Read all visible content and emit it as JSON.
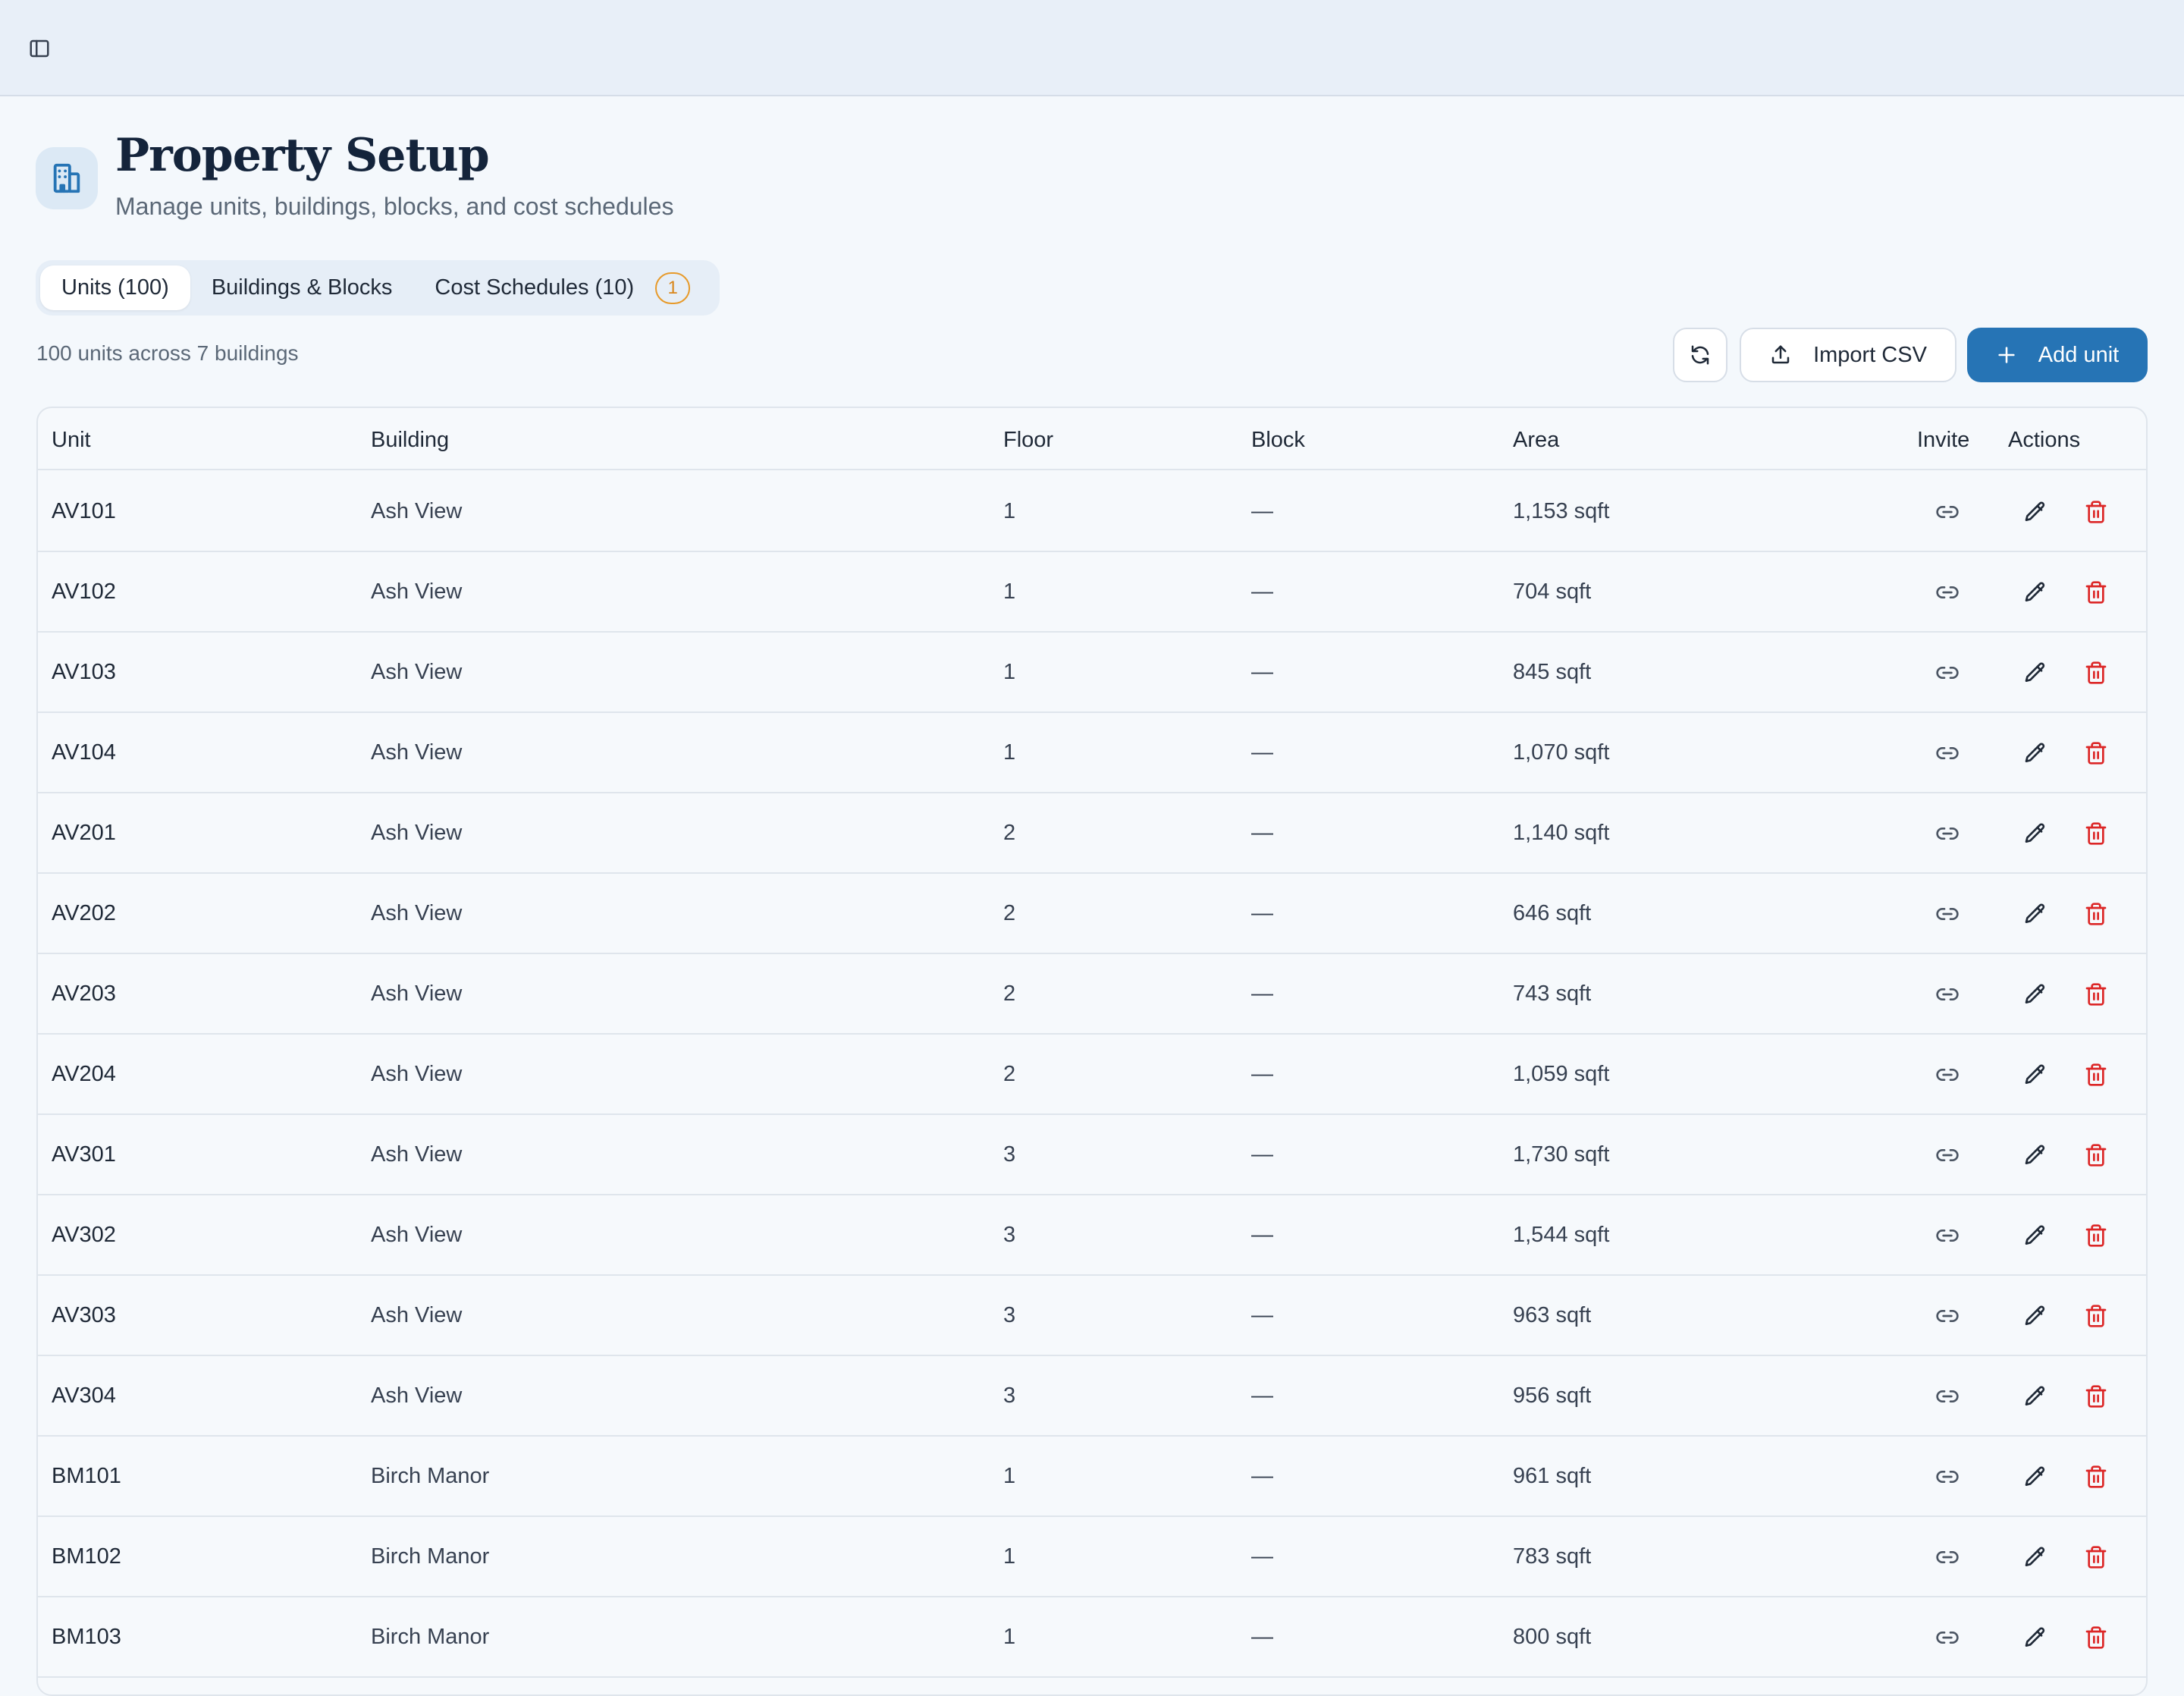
{
  "header": {
    "title": "Property Setup",
    "subtitle": "Manage units, buildings, blocks, and cost schedules"
  },
  "tabs": [
    {
      "label": "Units (100)",
      "active": true
    },
    {
      "label": "Buildings & Blocks",
      "active": false
    },
    {
      "label": "Cost Schedules (10)",
      "active": false,
      "badge": "1"
    }
  ],
  "summary": "100 units across 7 buildings",
  "toolbar": {
    "import_label": "Import CSV",
    "add_label": "Add unit"
  },
  "table": {
    "columns": [
      "Unit",
      "Building",
      "Floor",
      "Block",
      "Area",
      "Invite",
      "Actions"
    ],
    "rows": [
      {
        "unit": "AV101",
        "building": "Ash View",
        "floor": "1",
        "block": "—",
        "area": "1,153 sqft"
      },
      {
        "unit": "AV102",
        "building": "Ash View",
        "floor": "1",
        "block": "—",
        "area": "704 sqft"
      },
      {
        "unit": "AV103",
        "building": "Ash View",
        "floor": "1",
        "block": "—",
        "area": "845 sqft"
      },
      {
        "unit": "AV104",
        "building": "Ash View",
        "floor": "1",
        "block": "—",
        "area": "1,070 sqft"
      },
      {
        "unit": "AV201",
        "building": "Ash View",
        "floor": "2",
        "block": "—",
        "area": "1,140 sqft"
      },
      {
        "unit": "AV202",
        "building": "Ash View",
        "floor": "2",
        "block": "—",
        "area": "646 sqft"
      },
      {
        "unit": "AV203",
        "building": "Ash View",
        "floor": "2",
        "block": "—",
        "area": "743 sqft"
      },
      {
        "unit": "AV204",
        "building": "Ash View",
        "floor": "2",
        "block": "—",
        "area": "1,059 sqft"
      },
      {
        "unit": "AV301",
        "building": "Ash View",
        "floor": "3",
        "block": "—",
        "area": "1,730 sqft"
      },
      {
        "unit": "AV302",
        "building": "Ash View",
        "floor": "3",
        "block": "—",
        "area": "1,544 sqft"
      },
      {
        "unit": "AV303",
        "building": "Ash View",
        "floor": "3",
        "block": "—",
        "area": "963 sqft"
      },
      {
        "unit": "AV304",
        "building": "Ash View",
        "floor": "3",
        "block": "—",
        "area": "956 sqft"
      },
      {
        "unit": "BM101",
        "building": "Birch Manor",
        "floor": "1",
        "block": "—",
        "area": "961 sqft"
      },
      {
        "unit": "BM102",
        "building": "Birch Manor",
        "floor": "1",
        "block": "—",
        "area": "783 sqft"
      },
      {
        "unit": "BM103",
        "building": "Birch Manor",
        "floor": "1",
        "block": "—",
        "area": "800 sqft"
      }
    ]
  },
  "icons": {
    "sidebar_toggle": "sidebar-toggle-icon",
    "header": "building-icon",
    "refresh": "refresh-icon",
    "import": "upload-icon",
    "add": "plus-icon",
    "invite": "link-icon",
    "edit": "pencil-icon",
    "delete": "trash-icon"
  },
  "colors": {
    "accent": "#2674b5",
    "delete": "#dc2626",
    "badge": "#e79a2a"
  }
}
